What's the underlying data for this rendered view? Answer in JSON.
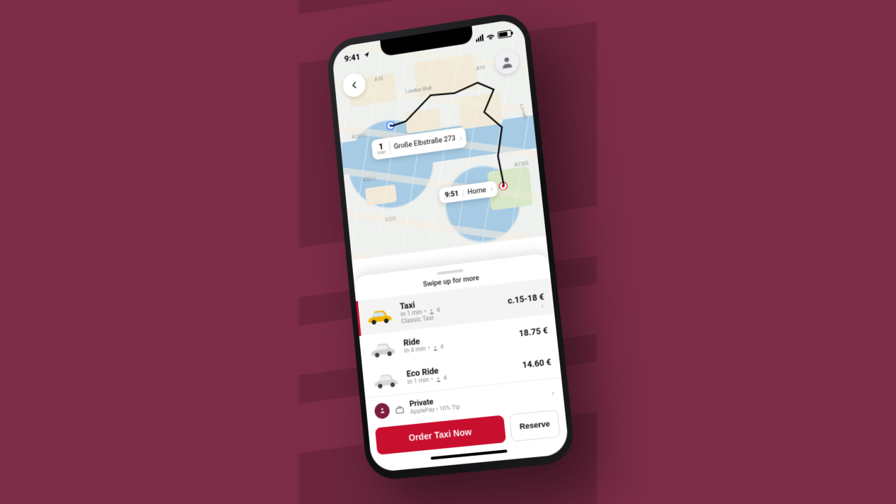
{
  "colors": {
    "brand": "#c8102e",
    "bg": "#7c2c46",
    "bg_dark": "#6b253c"
  },
  "status": {
    "time": "9:41"
  },
  "map": {
    "road_labels": [
      "London Wall",
      "A10",
      "A10",
      "Lamalt",
      "A1211",
      "A3211",
      "A1203",
      "A200"
    ],
    "pickup": {
      "eta_value": "1",
      "eta_unit": "min",
      "address": "Große Elbstraße 273"
    },
    "destination": {
      "eta": "9:51",
      "label": "Home"
    }
  },
  "sheet": {
    "swipe_label": "Swipe up for more",
    "rides": [
      {
        "id": "taxi",
        "name": "Taxi",
        "eta": "in 1 min",
        "seats": "4",
        "subtitle": "Classic Taxi",
        "price": "c.15-18 €",
        "selected": true,
        "car": "yellow"
      },
      {
        "id": "ride",
        "name": "Ride",
        "eta": "in 4 min",
        "seats": "4",
        "subtitle": "",
        "price": "18.75 €",
        "selected": false,
        "car": "silver"
      },
      {
        "id": "eco",
        "name": "Eco Ride",
        "eta": "in 1 min",
        "seats": "4",
        "subtitle": "",
        "price": "14.60 €",
        "selected": false,
        "car": "silver"
      }
    ],
    "payment": {
      "title": "Private",
      "subtitle": "ApplePay • 10% Tip"
    },
    "cta_primary": "Order Taxi Now",
    "cta_secondary": "Reserve"
  }
}
